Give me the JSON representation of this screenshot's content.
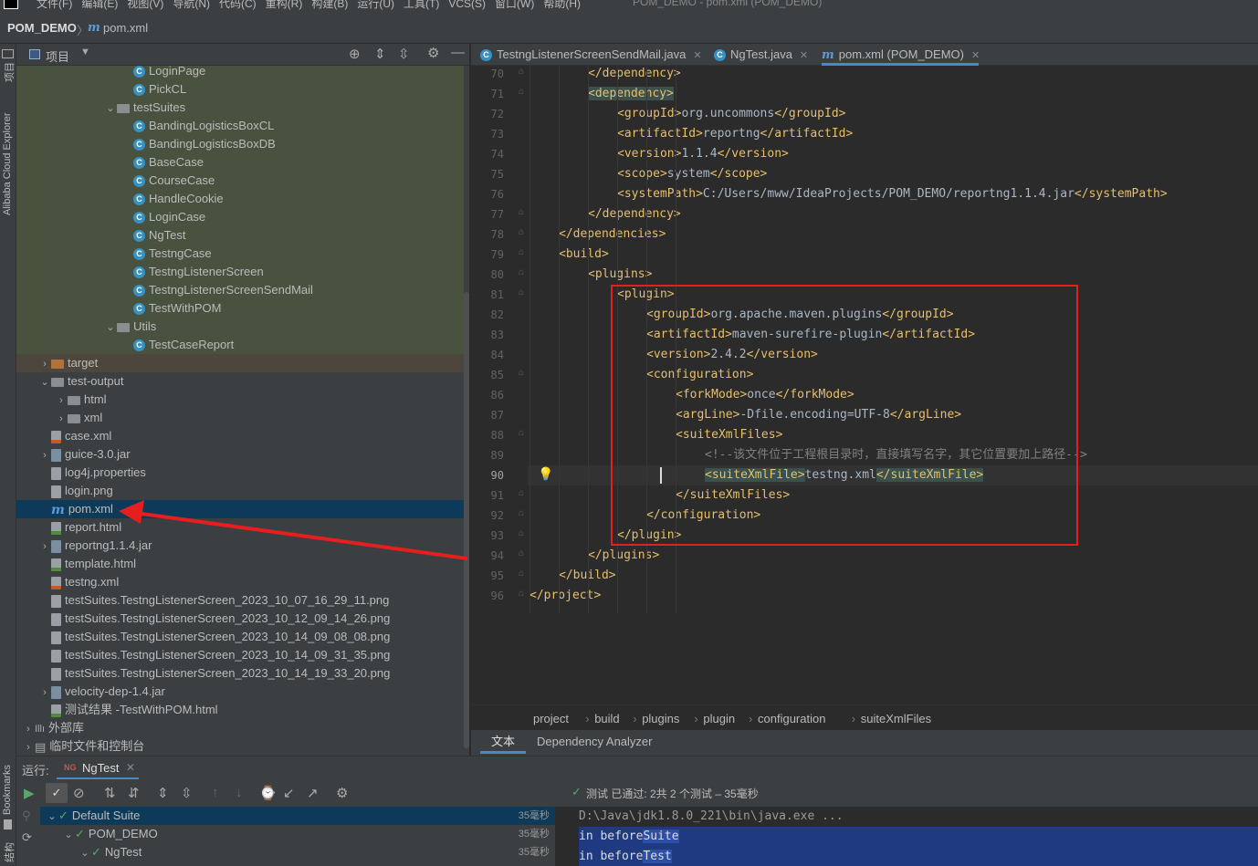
{
  "menubar": {
    "items": [
      "文件(F)",
      "编辑(E)",
      "视图(V)",
      "导航(N)",
      "代码(C)",
      "重构(R)",
      "构建(B)",
      "运行(U)",
      "工具(T)",
      "VCS(S)",
      "窗口(W)",
      "帮助(H)"
    ],
    "window_title": "POM_DEMO - pom.xml (POM_DEMO)"
  },
  "navbar": {
    "project": "POM_DEMO",
    "file_icon": "m",
    "file": "pom.xml"
  },
  "left_strip": {
    "project_label": "项目",
    "cloud_label": "Alibaba Cloud Explorer",
    "bookmarks_label": "Bookmarks",
    "structure_label": "结构"
  },
  "project_panel": {
    "title": "项目"
  },
  "tree": [
    {
      "label": "LoginPage",
      "icon": "class-icon",
      "indent": 6,
      "bg": "green"
    },
    {
      "label": "PickCL",
      "icon": "class-icon",
      "indent": 6,
      "bg": "green"
    },
    {
      "label": "testSuites",
      "icon": "package-icon",
      "indent": 5,
      "arrow": "down",
      "bg": "green"
    },
    {
      "label": "BandingLogisticsBoxCL",
      "icon": "class-icon",
      "indent": 6,
      "bg": "green"
    },
    {
      "label": "BandingLogisticsBoxDB",
      "icon": "class-icon",
      "indent": 6,
      "bg": "green"
    },
    {
      "label": "BaseCase",
      "icon": "class-icon",
      "indent": 6,
      "bg": "green"
    },
    {
      "label": "CourseCase",
      "icon": "class-icon",
      "indent": 6,
      "bg": "green"
    },
    {
      "label": "HandleCookie",
      "icon": "class-icon",
      "indent": 6,
      "bg": "green"
    },
    {
      "label": "LoginCase",
      "icon": "class-icon",
      "indent": 6,
      "bg": "green"
    },
    {
      "label": "NgTest",
      "icon": "class-icon",
      "indent": 6,
      "bg": "green"
    },
    {
      "label": "TestngCase",
      "icon": "class-icon",
      "indent": 6,
      "bg": "green"
    },
    {
      "label": "TestngListenerScreen",
      "icon": "class-icon",
      "indent": 6,
      "bg": "green"
    },
    {
      "label": "TestngListenerScreenSendMail",
      "icon": "class-icon",
      "indent": 6,
      "bg": "green"
    },
    {
      "label": "TestWithPOM",
      "icon": "class-icon",
      "indent": 6,
      "bg": "green"
    },
    {
      "label": "Utils",
      "icon": "package-icon",
      "indent": 5,
      "arrow": "down",
      "bg": "green"
    },
    {
      "label": "TestCaseReport",
      "icon": "class-icon",
      "indent": 6,
      "bg": "green"
    },
    {
      "label": "target",
      "icon": "folder-icon-orange",
      "indent": 1,
      "arrow": "right",
      "bg": "brown"
    },
    {
      "label": "test-output",
      "icon": "folder-icon",
      "indent": 1,
      "arrow": "down",
      "bg": ""
    },
    {
      "label": "html",
      "icon": "folder-icon",
      "indent": 2,
      "arrow": "right",
      "bg": ""
    },
    {
      "label": "xml",
      "icon": "folder-icon",
      "indent": 2,
      "arrow": "right",
      "bg": ""
    },
    {
      "label": "case.xml",
      "icon": "xml-file-icon",
      "indent": 1,
      "bg": ""
    },
    {
      "label": "guice-3.0.jar",
      "icon": "jar-icon",
      "indent": 1,
      "arrow": "right",
      "bg": ""
    },
    {
      "label": "log4j.properties",
      "icon": "properties-icon",
      "indent": 1,
      "bg": ""
    },
    {
      "label": "login.png",
      "icon": "image-icon",
      "indent": 1,
      "bg": ""
    },
    {
      "label": "pom.xml",
      "icon": "maven-icon",
      "indent": 1,
      "bg": "sel"
    },
    {
      "label": "report.html",
      "icon": "html-file-icon",
      "indent": 1,
      "bg": ""
    },
    {
      "label": "reportng1.1.4.jar",
      "icon": "jar-icon",
      "indent": 1,
      "arrow": "right",
      "bg": ""
    },
    {
      "label": "template.html",
      "icon": "html-file-icon",
      "indent": 1,
      "bg": ""
    },
    {
      "label": "testng.xml",
      "icon": "xml-file-icon",
      "indent": 1,
      "bg": ""
    },
    {
      "label": "testSuites.TestngListenerScreen_2023_10_07_16_29_11.png",
      "icon": "image-icon",
      "indent": 1,
      "bg": ""
    },
    {
      "label": "testSuites.TestngListenerScreen_2023_10_12_09_14_26.png",
      "icon": "image-icon",
      "indent": 1,
      "bg": ""
    },
    {
      "label": "testSuites.TestngListenerScreen_2023_10_14_09_08_08.png",
      "icon": "image-icon",
      "indent": 1,
      "bg": ""
    },
    {
      "label": "testSuites.TestngListenerScreen_2023_10_14_09_31_35.png",
      "icon": "image-icon",
      "indent": 1,
      "bg": ""
    },
    {
      "label": "testSuites.TestngListenerScreen_2023_10_14_19_33_20.png",
      "icon": "image-icon",
      "indent": 1,
      "bg": ""
    },
    {
      "label": "velocity-dep-1.4.jar",
      "icon": "jar-icon",
      "indent": 1,
      "arrow": "right",
      "bg": ""
    },
    {
      "label": "测试结果 -TestWithPOM.html",
      "icon": "html-file-icon",
      "indent": 1,
      "bg": ""
    },
    {
      "label": "外部库",
      "icon": "library-icon",
      "indent": 0,
      "arrow": "right",
      "bg": ""
    },
    {
      "label": "临时文件和控制台",
      "icon": "scratch-icon",
      "indent": 0,
      "arrow": "right",
      "bg": ""
    }
  ],
  "editor_tabs": [
    {
      "label": "TestngListenerScreenSendMail.java",
      "icon": "class-icon",
      "active": false
    },
    {
      "label": "NgTest.java",
      "icon": "class-icon",
      "active": false
    },
    {
      "label": "pom.xml (POM_DEMO)",
      "icon": "maven-icon",
      "active": true
    }
  ],
  "code_lines": [
    {
      "n": "70",
      "indent": 2,
      "text": "</dependency>"
    },
    {
      "n": "71",
      "indent": 2,
      "text": "<dependency>",
      "hl": true
    },
    {
      "n": "72",
      "indent": 3,
      "open": "<groupId>",
      "val": "org.uncommons",
      "close": "</groupId>"
    },
    {
      "n": "73",
      "indent": 3,
      "open": "<artifactId>",
      "val": "reportng",
      "close": "</artifactId>"
    },
    {
      "n": "74",
      "indent": 3,
      "open": "<version>",
      "val": "1.1.4",
      "close": "</version>"
    },
    {
      "n": "75",
      "indent": 3,
      "open": "<scope>",
      "val": "system",
      "close": "</scope>"
    },
    {
      "n": "76",
      "indent": 3,
      "open": "<systemPath>",
      "val": "C:/Users/mww/IdeaProjects/POM_DEMO/reportng1.1.4.jar",
      "close": "</systemPath>"
    },
    {
      "n": "77",
      "indent": 2,
      "text": "</dependency>"
    },
    {
      "n": "78",
      "indent": 1,
      "text": "</dependencies>"
    },
    {
      "n": "79",
      "indent": 1,
      "text": "<build>"
    },
    {
      "n": "80",
      "indent": 2,
      "text": "<plugins>"
    },
    {
      "n": "81",
      "indent": 3,
      "text": "<plugin>"
    },
    {
      "n": "82",
      "indent": 4,
      "open": "<groupId>",
      "val": "org.apache.maven.plugins",
      "close": "</groupId>"
    },
    {
      "n": "83",
      "indent": 4,
      "open": "<artifactId>",
      "val": "maven-surefire-plugin",
      "close": "</artifactId>"
    },
    {
      "n": "84",
      "indent": 4,
      "open": "<version>",
      "val": "2.4.2",
      "close": "</version>"
    },
    {
      "n": "85",
      "indent": 4,
      "text": "<configuration>"
    },
    {
      "n": "86",
      "indent": 5,
      "open": "<forkMode>",
      "val": "once",
      "close": "</forkMode>"
    },
    {
      "n": "87",
      "indent": 5,
      "open": "<argLine>",
      "val": "-Dfile.encoding=UTF-8",
      "close": "</argLine>"
    },
    {
      "n": "88",
      "indent": 5,
      "text": "<suiteXmlFiles>"
    },
    {
      "n": "89",
      "indent": 6,
      "comment": "<!--该文件位于工程根目录时，直接填写名字，其它位置要加上路径-->"
    },
    {
      "n": "90",
      "indent": 6,
      "open": "<suiteXmlFile>",
      "val": "testng.xml",
      "close": "</suiteXmlFile>",
      "current": true
    },
    {
      "n": "91",
      "indent": 5,
      "text": "</suiteXmlFiles>"
    },
    {
      "n": "92",
      "indent": 4,
      "text": "</configuration>"
    },
    {
      "n": "93",
      "indent": 3,
      "text": "</plugin>"
    },
    {
      "n": "94",
      "indent": 2,
      "text": "</plugins>"
    },
    {
      "n": "95",
      "indent": 1,
      "text": "</build>"
    },
    {
      "n": "96",
      "indent": 0,
      "text": "</project>"
    }
  ],
  "editor_breadcrumb": [
    "project",
    "build",
    "plugins",
    "plugin",
    "configuration",
    "suiteXmlFiles"
  ],
  "editor_bottom_tabs": [
    "文本",
    "Dependency Analyzer"
  ],
  "run": {
    "label": "运行:",
    "tab": "NgTest",
    "status": "测试 已通过: 2共 2 个测试 – 35毫秒",
    "tree": [
      {
        "label": "Default Suite",
        "time": "35毫秒",
        "indent": 0
      },
      {
        "label": "POM_DEMO",
        "time": "35毫秒",
        "indent": 1
      },
      {
        "label": "NgTest",
        "time": "35毫秒",
        "indent": 2
      }
    ],
    "console": [
      {
        "text": "D:\\Java\\jdk1.8.0_221\\bin\\java.exe ...",
        "prefix": "",
        "suffix": ""
      },
      {
        "prefix": "in before",
        "suffix": "Suite"
      },
      {
        "prefix": "in before",
        "suffix": "Test"
      }
    ]
  },
  "colors": {
    "accent": "#4a88c7",
    "annotation_red": "#e61e1e",
    "pass_green": "#59a869"
  }
}
